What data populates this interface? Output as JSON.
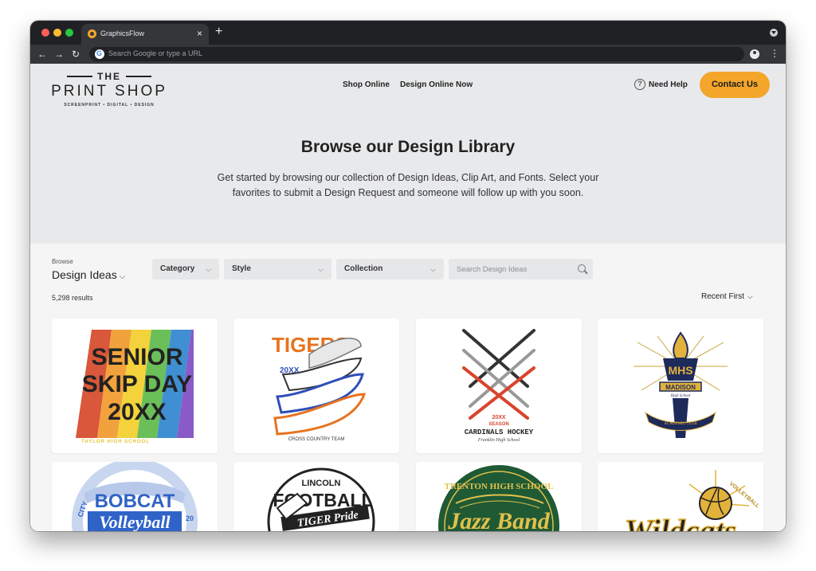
{
  "browser": {
    "tab_title": "GraphicsFlow",
    "omnibox_placeholder": "Search Google or type a URL",
    "close_glyph": "×",
    "new_tab_glyph": "+",
    "back_glyph": "←",
    "forward_glyph": "→",
    "reload_glyph": "↻",
    "menu_glyph": "⋮"
  },
  "header": {
    "logo": {
      "top": "THE",
      "main": "PRINT SHOP",
      "sub": "SCREENPRINT • DIGITAL • DESIGN"
    },
    "nav": [
      "Shop Online",
      "Design Online Now"
    ],
    "help_label": "Need Help",
    "help_glyph": "?",
    "contact_label": "Contact Us"
  },
  "hero": {
    "title": "Browse our Design Library",
    "text": "Get started by browsing our collection of Design Ideas, Clip Art, and Fonts. Select your favorites to submit a Design Request and someone will follow up with you soon."
  },
  "filters": {
    "browse_label": "Browse",
    "browse_value": "Design Ideas",
    "category": "Category",
    "style": "Style",
    "collection": "Collection",
    "search_placeholder": "Search Design Ideas",
    "results": "5,298 results",
    "sort": "Recent First",
    "chevron": "⌵"
  },
  "cards": {
    "senior": {
      "l1": "SENIOR",
      "l2": "SKIP DAY",
      "l3": "20XX",
      "l4": "TAYLOR HIGH SCHOOL"
    },
    "tigers": {
      "l1": "TIGERS",
      "l2": "20XX",
      "l3": "CROSS COUNTRY TEAM"
    },
    "hockey": {
      "l1": "20XX",
      "l2": "SEASON",
      "l3": "CARDINALS HOCKEY",
      "l4": "Franklin High School"
    },
    "mhs": {
      "l1": "MHS",
      "l2": "MADISON",
      "l3": "High School",
      "l4": "ACADEMIC CLUB"
    },
    "bobcat": {
      "l1": "BOBCAT",
      "l2": "Volleyball",
      "l3": "CITY",
      "l4": "20"
    },
    "football": {
      "l1": "LINCOLN",
      "l2": "FOOTBALL",
      "l3": "TIGER Pride"
    },
    "jazz": {
      "l1": "TRENTON HIGH SCHOOL",
      "l2": "Jazz Band"
    },
    "wildcats": {
      "l1": "Wildcats",
      "l2": "VOLLEYBALL"
    }
  },
  "colors": {
    "accent": "#f4a62a",
    "hero_bg": "#e8e9eb",
    "page_bg": "#f5f5f5",
    "chrome_dark": "#202124"
  }
}
